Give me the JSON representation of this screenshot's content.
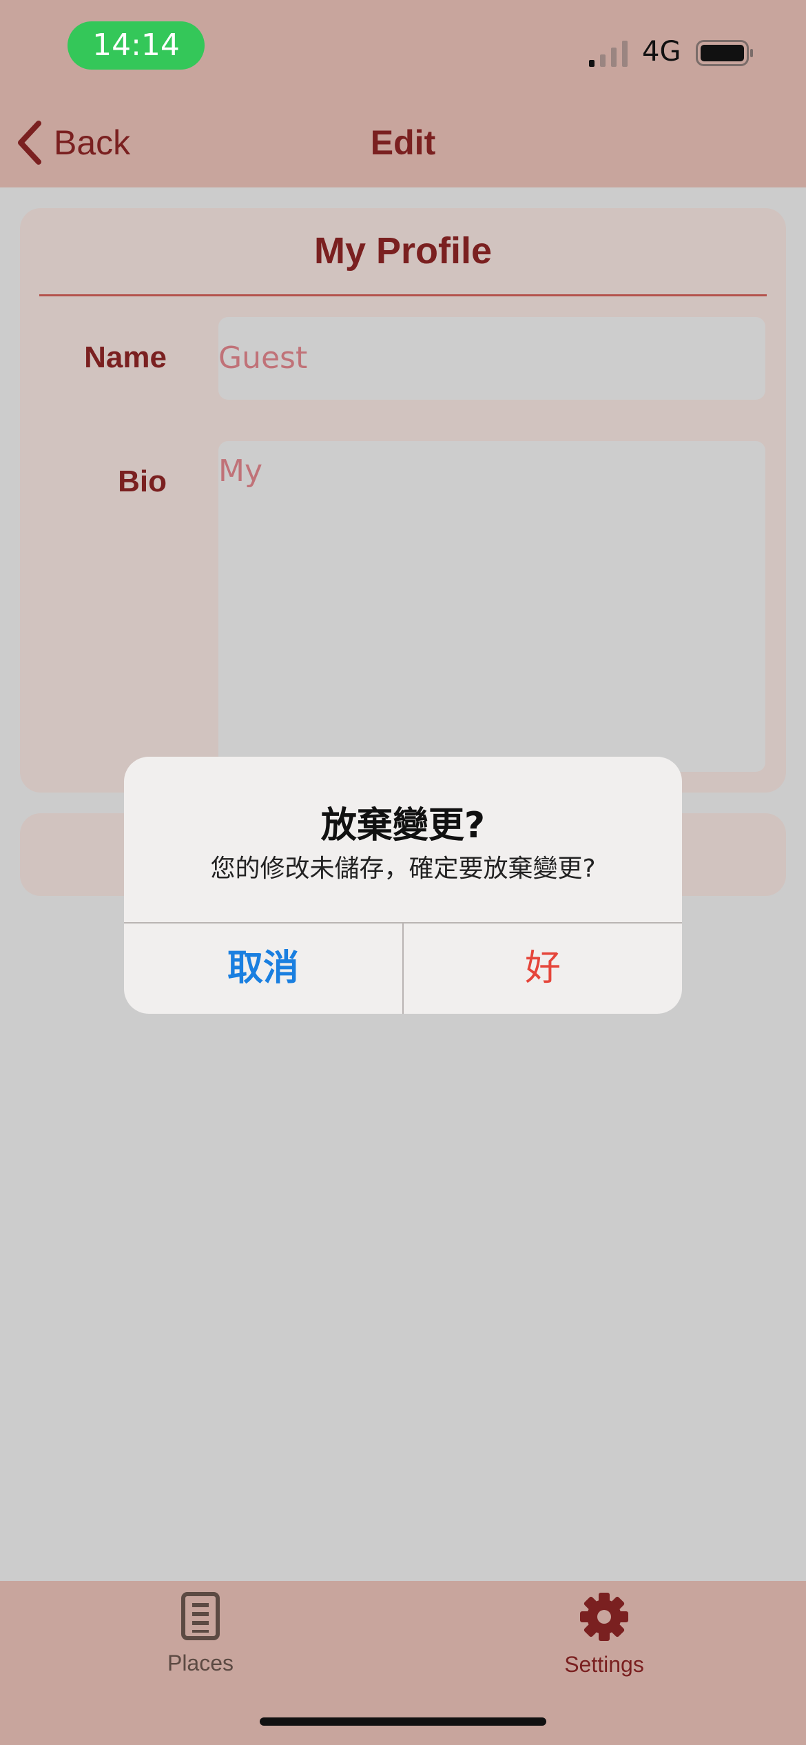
{
  "status_bar": {
    "time": "14:14",
    "network": "4G",
    "time_pill_color": "#34c759"
  },
  "nav": {
    "back_label": "Back",
    "title": "Edit"
  },
  "profile": {
    "title": "My Profile",
    "name_label": "Name",
    "name_value": "Guest",
    "bio_label": "Bio",
    "bio_value": "My"
  },
  "alert": {
    "title": "放棄變更?",
    "message": "您的修改未儲存，確定要放棄變更?",
    "cancel_label": "取消",
    "ok_label": "好"
  },
  "tabbar": {
    "items": [
      {
        "label": "Places",
        "icon": "document-list-icon"
      },
      {
        "label": "Settings",
        "icon": "gear-icon"
      }
    ]
  },
  "colors": {
    "accent": "#7a2020",
    "bar_background": "#c8a59d",
    "cancel": "#1a7fe0",
    "destructive": "#e5453a"
  }
}
